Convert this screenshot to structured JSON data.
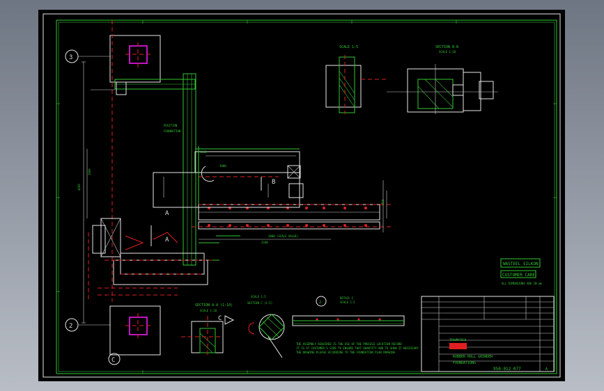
{
  "drawing": {
    "grid_labels": {
      "row_3": "3",
      "row_2": "2",
      "col_c": "C"
    },
    "views": {
      "scale_detail_1": "SCALE 1:5",
      "section_b_b": "SECTION  B-B",
      "section_b_b_scale": "SCALE 1:10",
      "section_a_a": "SECTION  A-A (1:10)",
      "section_a_a_scale": "SCALE 1:10",
      "scale_lower": "SCALE 1:5",
      "detail_2": "2",
      "detail_c_label": "DETAIL  C",
      "detail_c_scale": "SCALE 1:5",
      "arrow_c": "C"
    },
    "callouts": {
      "a_top": "A",
      "a_bottom": "A",
      "b_marker": "B"
    },
    "stamps": {
      "company": "WASTEEL SILKON",
      "customer": "CUSTOMER CARE",
      "note": "ALL DIMENSIONS ARE IN mm"
    },
    "notes": [
      "THE ASSEMBLY REQUIRED IS THE USE OF THE PROCESS LOCATION RECORD",
      "IT IS AT CUSTOMER'S SIDE TO ENSURE THAT QUANTITY AND TO SHOW IF NECESSARY",
      "THE DRAWING PLEASE ACCORDING TO THE FOUNDATION PLAN DRAWING"
    ],
    "title_block": {
      "project": "RUBBER ROLL GRINDER",
      "subtitle": "FOUNDATIONS",
      "number": "950-012-077",
      "revision": "A",
      "logo": "TRAUMATECH"
    }
  }
}
